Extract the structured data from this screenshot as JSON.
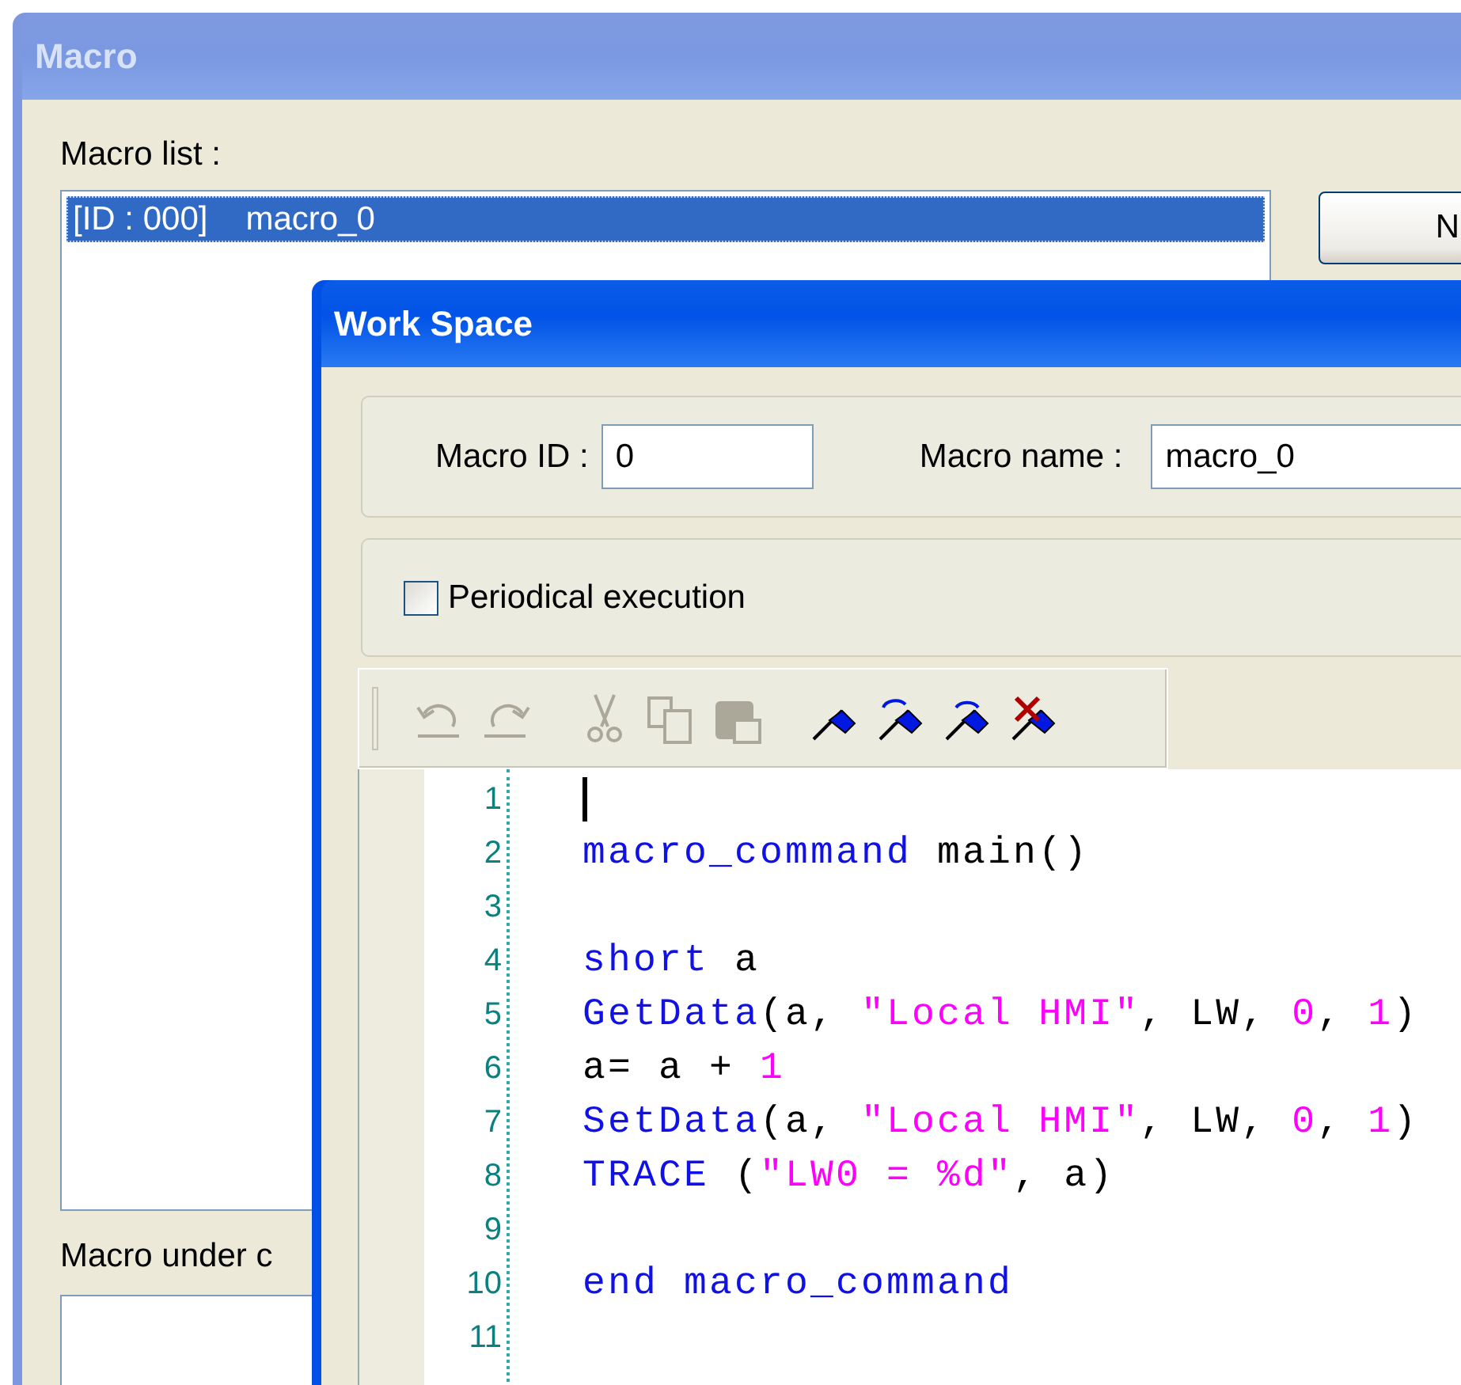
{
  "macro_window": {
    "title": "Macro",
    "list_label": "Macro list :",
    "macro_list": [
      {
        "id": "[ID : 000]",
        "name": "macro_0",
        "selected": true
      }
    ],
    "side_button": "N",
    "under_label": "Macro under c"
  },
  "work_space": {
    "title": "Work Space",
    "macro_id": {
      "label": "Macro ID :",
      "value": "0"
    },
    "macro_name": {
      "label": "Macro name :",
      "value": "macro_0"
    },
    "periodical": {
      "label": "Periodical execution",
      "checked": false
    },
    "toolbar": [
      {
        "kind": "undo",
        "disabled": true
      },
      {
        "kind": "redo",
        "disabled": true
      },
      {
        "kind": "cut",
        "disabled": true
      },
      {
        "kind": "copy",
        "disabled": true
      },
      {
        "kind": "paste",
        "disabled": true
      },
      {
        "kind": "bookmark",
        "disabled": false
      },
      {
        "kind": "next-bookmark",
        "disabled": false
      },
      {
        "kind": "prev-bookmark",
        "disabled": false
      },
      {
        "kind": "clear-bookmarks",
        "disabled": false
      }
    ],
    "editor": {
      "lines": [
        {
          "number": "1",
          "caret": true
        },
        {
          "number": "2",
          "caret": false,
          "tokens": [
            {
              "kind": "keyword",
              "text": "macro_command"
            },
            {
              "kind": "plain",
              "text": " main()"
            }
          ]
        },
        {
          "number": "3",
          "caret": false
        },
        {
          "number": "4",
          "caret": false,
          "tokens": [
            {
              "kind": "keyword",
              "text": "short"
            },
            {
              "kind": "plain",
              "text": " a"
            }
          ]
        },
        {
          "number": "5",
          "caret": false,
          "tokens": [
            {
              "kind": "keyword",
              "text": "GetData"
            },
            {
              "kind": "plain",
              "text": "(a, "
            },
            {
              "kind": "string",
              "text": "\"Local HMI\""
            },
            {
              "kind": "plain",
              "text": ", LW, "
            },
            {
              "kind": "number",
              "text": "0"
            },
            {
              "kind": "plain",
              "text": ", "
            },
            {
              "kind": "number",
              "text": "1"
            },
            {
              "kind": "plain",
              "text": ")"
            }
          ]
        },
        {
          "number": "6",
          "caret": false,
          "tokens": [
            {
              "kind": "plain",
              "text": "a= a + "
            },
            {
              "kind": "number",
              "text": "1"
            }
          ]
        },
        {
          "number": "7",
          "caret": false,
          "tokens": [
            {
              "kind": "keyword",
              "text": "SetData"
            },
            {
              "kind": "plain",
              "text": "(a, "
            },
            {
              "kind": "string",
              "text": "\"Local HMI\""
            },
            {
              "kind": "plain",
              "text": ", LW, "
            },
            {
              "kind": "number",
              "text": "0"
            },
            {
              "kind": "plain",
              "text": ", "
            },
            {
              "kind": "number",
              "text": "1"
            },
            {
              "kind": "plain",
              "text": ")"
            }
          ]
        },
        {
          "number": "8",
          "caret": false,
          "tokens": [
            {
              "kind": "keyword",
              "text": "TRACE"
            },
            {
              "kind": "plain",
              "text": " ("
            },
            {
              "kind": "string",
              "text": "\"LW0 = %d\""
            },
            {
              "kind": "plain",
              "text": ", a)"
            }
          ]
        },
        {
          "number": "9",
          "caret": false
        },
        {
          "number": "10",
          "caret": false,
          "tokens": [
            {
              "kind": "keyword",
              "text": "end macro_command"
            }
          ]
        },
        {
          "number": "11",
          "caret": false
        }
      ]
    }
  }
}
